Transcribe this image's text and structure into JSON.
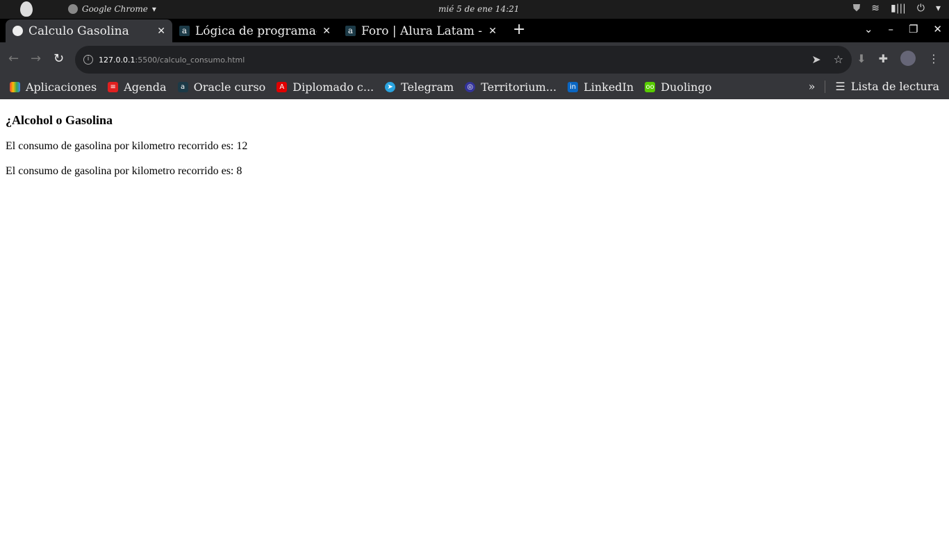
{
  "system_bar": {
    "app_name": "Google Chrome",
    "clock": "mié  5 de ene  14:21"
  },
  "tabs": [
    {
      "title": "Calculo Gasolina",
      "active": true,
      "icon": "globe-icon"
    },
    {
      "title": "Lógica de programación",
      "icon": "alura-icon"
    },
    {
      "title": "Foro | Alura Latam - Cursos",
      "icon": "alura-icon"
    }
  ],
  "address": {
    "host": "127.0.0.1",
    "path": ":5500/calculo_consumo.html"
  },
  "bookmarks": [
    {
      "label": "Aplicaciones",
      "color": "#4285f4"
    },
    {
      "label": "Agenda",
      "color": "#e02020"
    },
    {
      "label": "Oracle curso",
      "color": "#1c3a47"
    },
    {
      "label": "Diplomado c...",
      "color": "#e00000"
    },
    {
      "label": "Telegram",
      "color": "#2aa3df"
    },
    {
      "label": "Territorium...",
      "color": "#333399"
    },
    {
      "label": "LinkedIn",
      "color": "#0a66c2"
    },
    {
      "label": "Duolingo",
      "color": "#58cc02"
    }
  ],
  "reading_list": "Lista de lectura",
  "page": {
    "heading": "¿Alcohol o Gasolina",
    "lines": [
      "El consumo de gasolina por kilometro recorrido es: 12",
      "El consumo de gasolina por kilometro recorrido es: 8"
    ]
  }
}
